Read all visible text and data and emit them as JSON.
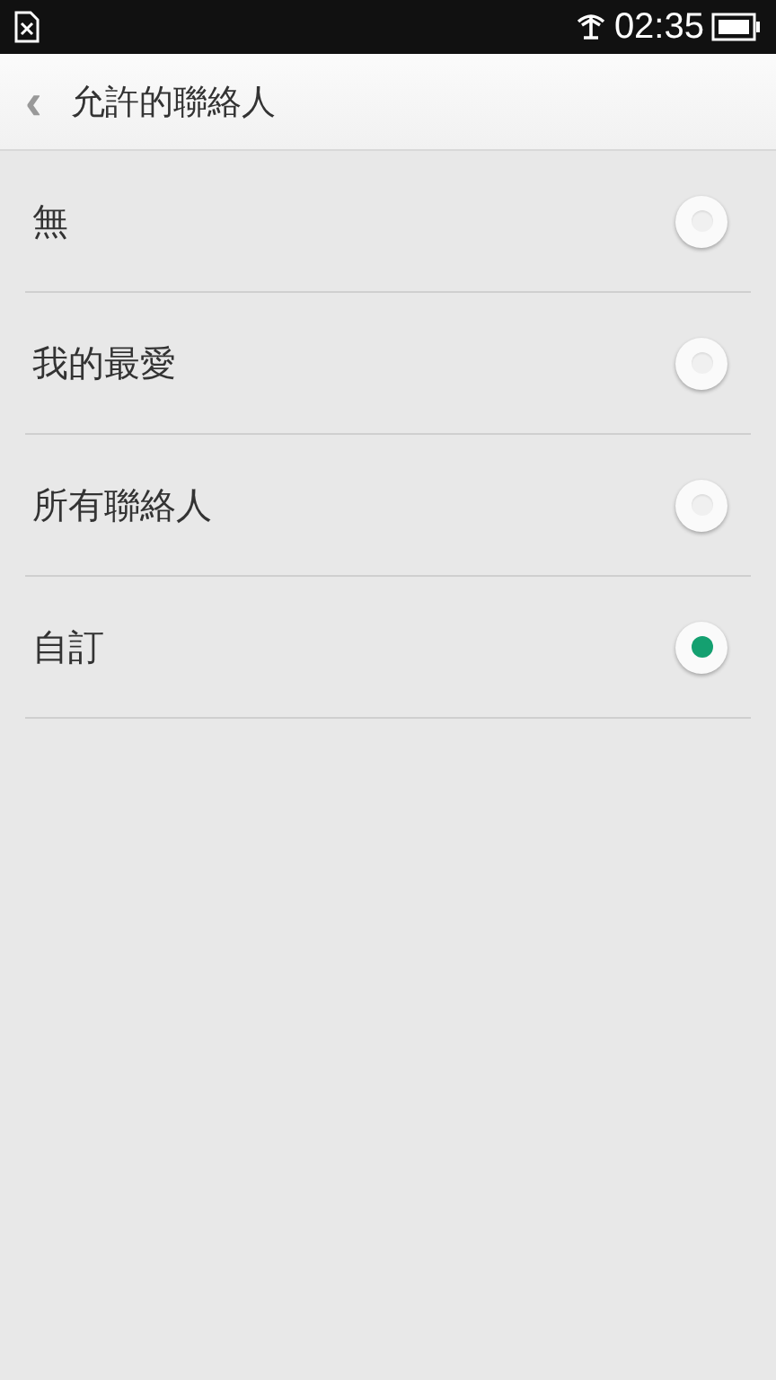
{
  "status_bar": {
    "time": "02:35"
  },
  "header": {
    "back": "‹",
    "title": "允許的聯絡人"
  },
  "options": [
    {
      "label": "無",
      "selected": false
    },
    {
      "label": "我的最愛",
      "selected": false
    },
    {
      "label": "所有聯絡人",
      "selected": false
    },
    {
      "label": "自訂",
      "selected": true
    }
  ]
}
